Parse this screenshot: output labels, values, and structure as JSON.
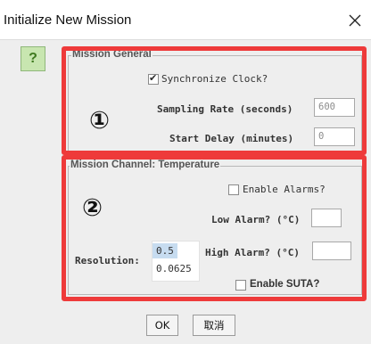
{
  "window": {
    "title": "Initialize New Mission",
    "close_icon": "close-icon",
    "close_glyph": "✕"
  },
  "help": {
    "label": "?"
  },
  "mission_general": {
    "title": "Mission General",
    "badge": "①",
    "synchronize_clock": {
      "label": "Synchronize Clock?",
      "checked": true
    },
    "sampling_rate": {
      "label": "Sampling Rate (seconds)",
      "value": "600"
    },
    "start_delay": {
      "label": "Start Delay (minutes)",
      "value": "0"
    }
  },
  "mission_channel": {
    "title": "Mission Channel: Temperature",
    "badge": "②",
    "enable_alarms": {
      "label": "Enable Alarms?",
      "checked": false
    },
    "low_alarm": {
      "label": "Low Alarm? (°C)",
      "value": ""
    },
    "high_alarm": {
      "label": "High Alarm? (°C)",
      "value": ""
    },
    "resolution": {
      "label": "Resolution:",
      "options": [
        "0.5",
        "0.0625"
      ],
      "selected": "0.5"
    },
    "enable_suta": {
      "label": "Enable SUTA?",
      "checked": false
    }
  },
  "buttons": {
    "ok": "OK",
    "cancel": "取消"
  },
  "colors": {
    "highlight_border": "#ee3a3a",
    "help_bg": "#c8e6b0",
    "selected_bg": "#c7dcf0"
  }
}
